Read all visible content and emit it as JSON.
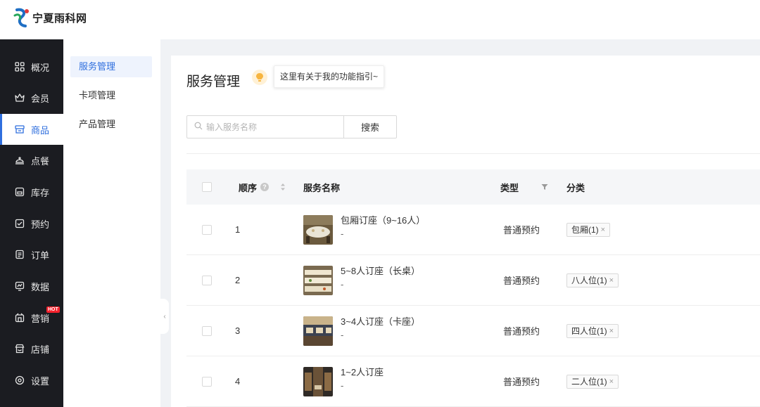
{
  "app": {
    "logo_text": "宁夏雨科网"
  },
  "nav": {
    "items": [
      {
        "label": "概况",
        "icon": "grid-icon"
      },
      {
        "label": "会员",
        "icon": "crown-icon"
      },
      {
        "label": "商品",
        "icon": "shop-icon",
        "active": true
      },
      {
        "label": "点餐",
        "icon": "dish-icon"
      },
      {
        "label": "库存",
        "icon": "inventory-icon"
      },
      {
        "label": "预约",
        "icon": "calendar-check-icon"
      },
      {
        "label": "订单",
        "icon": "order-icon"
      },
      {
        "label": "数据",
        "icon": "chart-icon"
      },
      {
        "label": "营销",
        "icon": "marketing-icon",
        "badge": "HOT"
      },
      {
        "label": "店铺",
        "icon": "store-icon"
      },
      {
        "label": "设置",
        "icon": "settings-icon"
      }
    ],
    "accent_color": "#2f6fde"
  },
  "subnav": {
    "items": [
      {
        "label": "服务管理",
        "active": true
      },
      {
        "label": "卡项管理"
      },
      {
        "label": "产品管理"
      }
    ]
  },
  "page": {
    "title": "服务管理",
    "guide_tip": "这里有关于我的功能指引~"
  },
  "search": {
    "placeholder": "输入服务名称",
    "value": "",
    "button_label": "搜索"
  },
  "table": {
    "headers": {
      "order": "顺序",
      "name": "服务名称",
      "type": "类型",
      "category": "分类"
    },
    "rows": [
      {
        "order": "1",
        "name": "包厢订座（9~16人）",
        "sub": "-",
        "type": "普通预约",
        "category": "包厢(1)",
        "image": "banquet-room"
      },
      {
        "order": "2",
        "name": "5~8人订座（长桌）",
        "sub": "-",
        "type": "普通预约",
        "category": "八人位(1)",
        "image": "long-table"
      },
      {
        "order": "3",
        "name": "3~4人订座（卡座）",
        "sub": "-",
        "type": "普通预约",
        "category": "四人位(1)",
        "image": "booth-seat"
      },
      {
        "order": "4",
        "name": "1~2人订座",
        "sub": "-",
        "type": "普通预约",
        "category": "二人位(1)",
        "image": "small-table"
      }
    ]
  }
}
